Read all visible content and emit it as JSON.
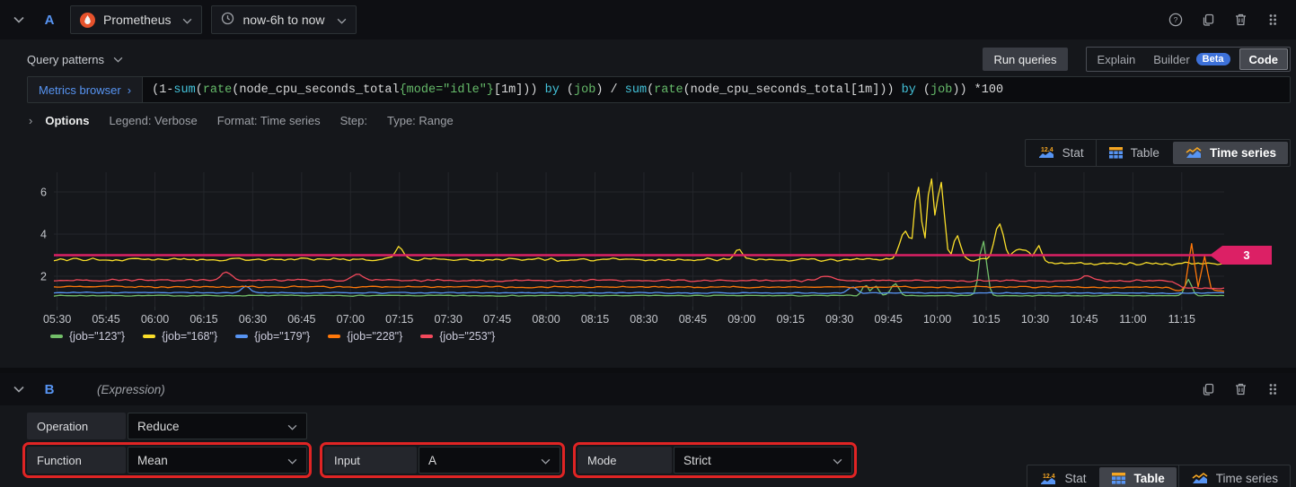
{
  "queryA": {
    "ref_id": "A",
    "datasource_name": "Prometheus",
    "time_range": "now-6h to now",
    "query_patterns_label": "Query patterns",
    "run_queries_label": "Run queries",
    "mode_toggle": {
      "explain": "Explain",
      "builder": "Builder",
      "beta_badge": "Beta",
      "code": "Code",
      "selected": "Code"
    },
    "metrics_browser_label": "Metrics browser",
    "metrics_browser_chevron": "›",
    "expr_tokens": [
      {
        "t": "(1-",
        "c": "plain"
      },
      {
        "t": "sum",
        "c": "kw"
      },
      {
        "t": "(",
        "c": "plain"
      },
      {
        "t": "rate",
        "c": "fn"
      },
      {
        "t": "(",
        "c": "plain"
      },
      {
        "t": "node_cpu_seconds_total",
        "c": "plain"
      },
      {
        "t": "{mode=\"idle\"}",
        "c": "fn"
      },
      {
        "t": "[1m])) ",
        "c": "plain"
      },
      {
        "t": "by",
        "c": "kw"
      },
      {
        "t": " (",
        "c": "plain"
      },
      {
        "t": "job",
        "c": "fn"
      },
      {
        "t": ") / ",
        "c": "plain"
      },
      {
        "t": "sum",
        "c": "kw"
      },
      {
        "t": "(",
        "c": "plain"
      },
      {
        "t": "rate",
        "c": "fn"
      },
      {
        "t": "(node_cpu_seconds_total[1m])) ",
        "c": "plain"
      },
      {
        "t": "by",
        "c": "kw"
      },
      {
        "t": " (",
        "c": "plain"
      },
      {
        "t": "job",
        "c": "fn"
      },
      {
        "t": ")) *100",
        "c": "plain"
      }
    ],
    "options_row": {
      "chevron": "›",
      "options_label": "Options",
      "legend": "Legend: Verbose",
      "format": "Format: Time series",
      "step": "Step:",
      "type": "Type: Range"
    },
    "view_toggle": {
      "items": [
        {
          "label": "Stat",
          "icon": "stat"
        },
        {
          "label": "Table",
          "icon": "table"
        },
        {
          "label": "Time series",
          "icon": "timeseries"
        }
      ],
      "selected": "Time series",
      "stat_icon_text": "12.4"
    }
  },
  "chart_data": {
    "type": "line",
    "title": "",
    "x_ticks": [
      "05:30",
      "05:45",
      "06:00",
      "06:15",
      "06:30",
      "06:45",
      "07:00",
      "07:15",
      "07:30",
      "07:45",
      "08:00",
      "08:15",
      "08:30",
      "08:45",
      "09:00",
      "09:15",
      "09:30",
      "09:45",
      "10:00",
      "10:15",
      "10:30",
      "10:45",
      "11:00",
      "11:15"
    ],
    "x_range": [
      "05:29",
      "11:28"
    ],
    "y_ticks": [
      2,
      4,
      6
    ],
    "y_range": [
      0.5,
      6.9
    ],
    "grid": true,
    "legend_position": "bottom",
    "threshold": {
      "value": 3,
      "label": "3",
      "color": "#dc2065"
    },
    "series": [
      {
        "name": "{job=\"123\"}",
        "color": "#73bf69",
        "noise": 0.028,
        "base": [
          [
            "05:29",
            1.08
          ],
          [
            "11:28",
            1.08
          ]
        ],
        "spikes": [
          [
            "09:38",
            1.6,
            1.0
          ],
          [
            "09:41",
            1.55,
            1.0
          ],
          [
            "09:47",
            1.65,
            1.2
          ],
          [
            "10:14",
            3.7,
            1.1
          ],
          [
            "11:17",
            1.85,
            1.0
          ]
        ]
      },
      {
        "name": "{job=\"168\"}",
        "color": "#fade2a",
        "noise": 0.09,
        "base": [
          [
            "05:29",
            2.8
          ],
          [
            "10:31",
            2.78
          ],
          [
            "10:34",
            2.6
          ],
          [
            "11:28",
            2.6
          ]
        ],
        "spikes": [
          [
            "07:15",
            3.35,
            1.2
          ],
          [
            "08:59",
            3.28,
            1.2
          ],
          [
            "09:50",
            4.15,
            1.6
          ],
          [
            "09:54",
            6.3,
            1.1
          ],
          [
            "09:58",
            6.68,
            1.1
          ],
          [
            "10:01",
            6.55,
            1.1
          ],
          [
            "10:06",
            3.9,
            1.1
          ],
          [
            "10:19",
            4.5,
            1.4
          ],
          [
            "10:26",
            3.3,
            2.5
          ],
          [
            "10:31",
            3.5,
            1.0
          ]
        ]
      },
      {
        "name": "{job=\"179\"}",
        "color": "#5794f2",
        "noise": 0.03,
        "base": [
          [
            "05:29",
            1.22
          ],
          [
            "11:28",
            1.2
          ]
        ],
        "spikes": [
          [
            "06:28",
            1.52,
            1.2
          ],
          [
            "09:34",
            1.48,
            1.2
          ]
        ]
      },
      {
        "name": "{job=\"228\"}",
        "color": "#ff780a",
        "noise": 0.045,
        "base": [
          [
            "05:29",
            1.5
          ],
          [
            "11:10",
            1.48
          ],
          [
            "11:14",
            1.32
          ],
          [
            "11:28",
            1.3
          ]
        ],
        "spikes": [
          [
            "11:18",
            3.55,
            0.9
          ],
          [
            "11:22",
            2.95,
            0.9
          ]
        ]
      },
      {
        "name": "{job=\"253\"}",
        "color": "#f2495c",
        "noise": 0.055,
        "base": [
          [
            "05:29",
            1.82
          ],
          [
            "11:12",
            1.78
          ],
          [
            "11:16",
            1.45
          ],
          [
            "11:28",
            1.43
          ]
        ],
        "spikes": [
          [
            "06:22",
            2.2,
            1.6
          ],
          [
            "07:02",
            2.1,
            1.6
          ],
          [
            "09:26",
            2.0,
            1.8
          ],
          [
            "10:46",
            2.05,
            1.6
          ]
        ]
      }
    ],
    "legend": [
      {
        "label": "{job=\"123\"}",
        "color": "#73bf69"
      },
      {
        "label": "{job=\"168\"}",
        "color": "#fade2a"
      },
      {
        "label": "{job=\"179\"}",
        "color": "#5794f2"
      },
      {
        "label": "{job=\"228\"}",
        "color": "#ff780a"
      },
      {
        "label": "{job=\"253\"}",
        "color": "#f2495c"
      }
    ]
  },
  "queryB": {
    "ref_id": "B",
    "subtitle": "(Expression)",
    "fields": [
      {
        "label": "Operation",
        "value": "Reduce"
      },
      {
        "label": "Function",
        "value": "Mean"
      },
      {
        "label": "Input",
        "value": "A"
      },
      {
        "label": "Mode",
        "value": "Strict"
      }
    ],
    "highlight_color": "#e02424",
    "view_toggle": {
      "items": [
        {
          "label": "Stat",
          "icon": "stat"
        },
        {
          "label": "Table",
          "icon": "table"
        },
        {
          "label": "Time series",
          "icon": "timeseries"
        }
      ],
      "selected": "Table",
      "stat_icon_text": "12.4"
    }
  },
  "colors": {
    "accent_blue": "#5794f2",
    "threshold_pink": "#dc2065",
    "beta_blue": "#3d71d9"
  }
}
